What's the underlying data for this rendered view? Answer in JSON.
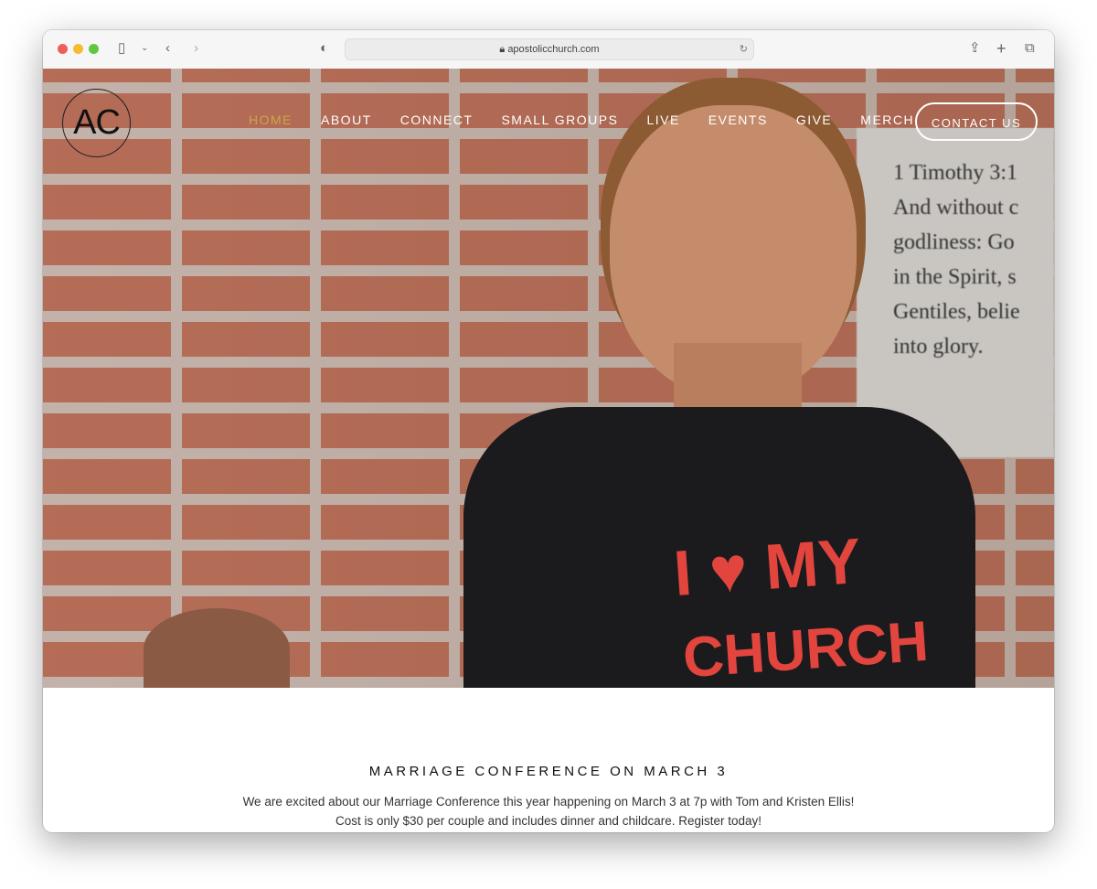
{
  "browser": {
    "url": "apostolicchurch.com"
  },
  "site": {
    "logo": "AC",
    "nav": [
      {
        "label": "HOME",
        "active": true
      },
      {
        "label": "ABOUT"
      },
      {
        "label": "CONNECT"
      },
      {
        "label": "SMALL GROUPS"
      },
      {
        "label": "LIVE"
      },
      {
        "label": "EVENTS"
      },
      {
        "label": "GIVE"
      },
      {
        "label": "MERCH"
      }
    ],
    "contact_label": "CONTACT US",
    "accent_color": "#c9a646"
  },
  "hero": {
    "plaque_text": "1 Timothy 3:1\nAnd without c\ngodliness: Go\nin the Spirit, s\nGentiles, belie\ninto glory.",
    "shirt_line1": "I ♥ MY",
    "shirt_line2": "CHURCH"
  },
  "announcement": {
    "title": "MARRIAGE CONFERENCE ON MARCH 3",
    "line1": "We are excited about our Marriage Conference this year happening on March 3 at 7p with Tom and Kristen Ellis!",
    "line2": "Cost is only $30 per couple and includes dinner and childcare. Register today!"
  }
}
